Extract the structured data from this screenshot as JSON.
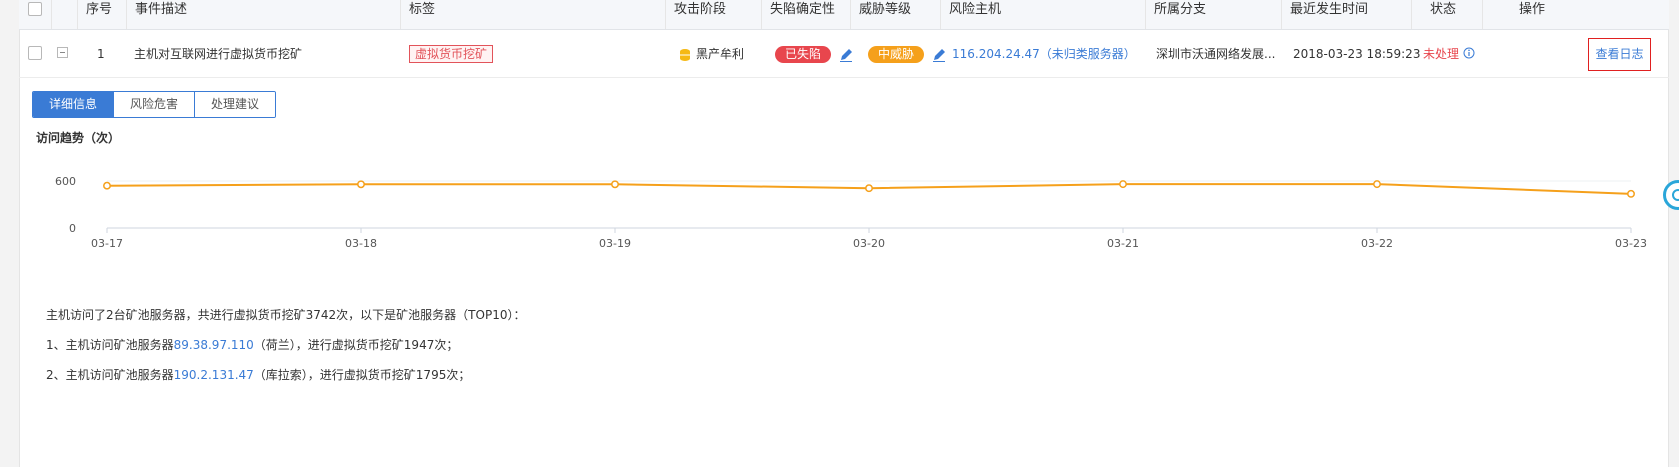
{
  "header": {
    "columns": [
      "序号",
      "事件描述",
      "标签",
      "攻击阶段",
      "失陷确定性",
      "威胁等级",
      "风险主机",
      "所属分支",
      "最近发生时间",
      "状态",
      "操作"
    ]
  },
  "row": {
    "index": "1",
    "description": "主机对互联网进行虚拟货币挖矿",
    "tag": "虚拟货币挖矿",
    "attack_stage": "黑产牟利",
    "compromise": "已失陷",
    "threat_level": "中威胁",
    "host": "116.204.24.47（未归类服务器）",
    "branch": "深圳市沃通网络发展...",
    "last_time": "2018-03-23 18:59:23",
    "status": "未处理",
    "action": "查看日志"
  },
  "tabs": [
    "详细信息",
    "风险危害",
    "处理建议"
  ],
  "chart_data": {
    "type": "line",
    "title": "访问趋势（次）",
    "categories": [
      "03-17",
      "03-18",
      "03-19",
      "03-20",
      "03-21",
      "03-22",
      "03-23"
    ],
    "series": [
      {
        "values": [
          540,
          558,
          558,
          508,
          560,
          560,
          436
        ]
      }
    ],
    "yticks": [
      0,
      600
    ],
    "ylim": [
      0,
      800
    ],
    "color": "#f5a01b"
  },
  "details": {
    "summary": "主机访问了2台矿池服务器，共进行虚拟货币挖矿3742次，以下是矿池服务器（TOP10）：",
    "items": [
      {
        "prefix": "1、主机访问矿池服务器",
        "ip": "89.38.97.110",
        "suffix": "（荷兰），进行虚拟货币挖矿1947次；"
      },
      {
        "prefix": "2、主机访问矿池服务器",
        "ip": "190.2.131.47",
        "suffix": "（库拉索），进行虚拟货币挖矿1795次；"
      }
    ]
  },
  "colors": {
    "accent": "#3a7bd5",
    "danger": "#e8464d",
    "warning": "#f5a01b",
    "line": "#f5a01b"
  }
}
